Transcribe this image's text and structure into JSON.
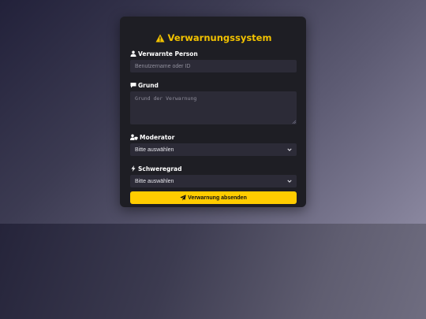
{
  "page": {
    "title": "Verwarnungssystem",
    "accent_color": "#ffcc00",
    "title_color": "#f2c200"
  },
  "form": {
    "person": {
      "label": "Verwarnte Person",
      "icon": "user-icon",
      "placeholder": "Benutzername oder ID"
    },
    "reason": {
      "label": "Grund",
      "icon": "comment-icon",
      "placeholder": "Grund der Verwarnung"
    },
    "moderator": {
      "label": "Moderator",
      "icon": "user-shield-icon",
      "selected": "Bitte auswählen"
    },
    "severity": {
      "label": "Schweregrad",
      "icon": "bolt-icon",
      "selected": "Bitte auswählen"
    },
    "submit": {
      "label": "Verwarnung absenden",
      "icon": "paper-plane-icon"
    }
  }
}
